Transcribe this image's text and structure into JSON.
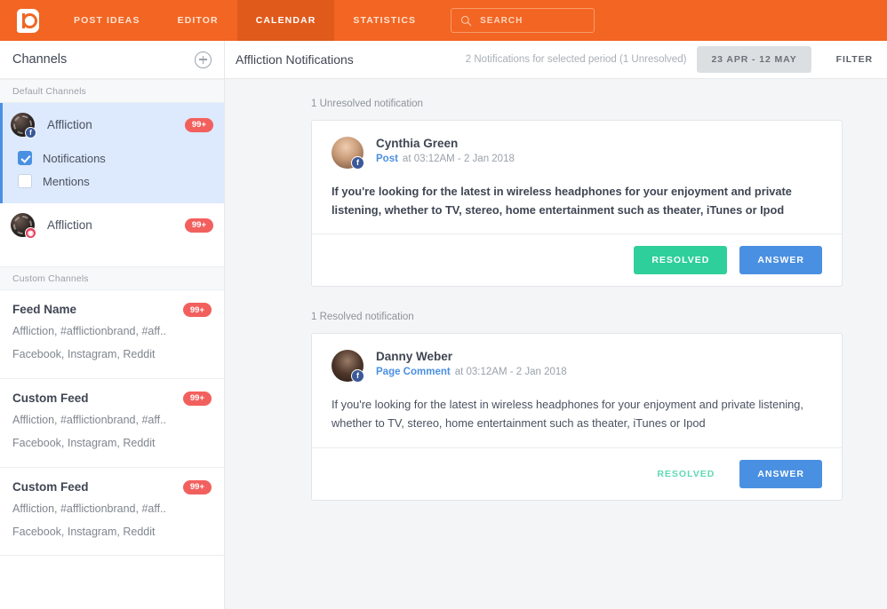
{
  "topnav": {
    "logo_name": "post-planner-logo",
    "items": [
      {
        "label": "POST IDEAS",
        "active": false
      },
      {
        "label": "EDITOR",
        "active": false
      },
      {
        "label": "CALENDAR",
        "active": true
      },
      {
        "label": "STATISTICS",
        "active": false
      }
    ],
    "search_placeholder": "SEARCH",
    "search_value": "",
    "brand_color": "#f26522",
    "active_tab_color": "#e05a1c"
  },
  "sidebar": {
    "title": "Channels",
    "add_button_name": "add-channel",
    "groups": [
      {
        "label": "Default Channels",
        "channels": [
          {
            "name": "Affliction",
            "badge": "99+",
            "network": "facebook",
            "selected": true,
            "subitems": [
              {
                "label": "Notifications",
                "checked": true
              },
              {
                "label": "Mentions",
                "checked": false
              }
            ]
          },
          {
            "name": "Affliction",
            "badge": "99+",
            "network": "instagram",
            "selected": false,
            "subitems": []
          }
        ]
      }
    ],
    "custom_label": "Custom Channels",
    "feeds": [
      {
        "name": "Feed Name",
        "badge": "99+",
        "keywords": "Affliction, #afflictionbrand, #aff..",
        "networks": "Facebook, Instagram, Reddit"
      },
      {
        "name": "Custom Feed",
        "badge": "99+",
        "keywords": "Affliction, #afflictionbrand, #aff..",
        "networks": "Facebook, Instagram, Reddit"
      },
      {
        "name": "Custom Feed",
        "badge": "99+",
        "keywords": "Affliction, #afflictionbrand, #aff..",
        "networks": "Facebook, Instagram, Reddit"
      }
    ],
    "badge_color": "#f2605e"
  },
  "main": {
    "title": "Affliction Notifications",
    "meta": "2 Notifications for selected period (1 Unresolved)",
    "date_range": "23 APR - 12 MAY",
    "filter_label": "FILTER",
    "unresolved_section_label": "1 Unresolved notification",
    "resolved_section_label": "1 Resolved notification",
    "cards": [
      {
        "author": "Cynthia Green",
        "kind": "Post",
        "time": "at 03:12AM - 2 Jan 2018",
        "network": "facebook",
        "message": "If you're looking for the latest in wireless headphones for your enjoyment and private listening, whether to TV, stereo, home entertainment such as theater, iTunes or Ipod",
        "resolved_label": "RESOLVED",
        "answer_label": "ANSWER",
        "resolved_style": "filled"
      },
      {
        "author": "Danny Weber",
        "kind": "Page Comment",
        "time": "at 03:12AM - 2 Jan 2018",
        "network": "facebook",
        "message": "If you're looking for the latest in wireless headphones for your enjoyment and private listening, whether to TV, stereo, home entertainment such as theater, iTunes or Ipod",
        "resolved_label": "RESOLVED",
        "answer_label": "ANSWER",
        "resolved_style": "flat"
      }
    ],
    "accent_green": "#2ecf9b",
    "accent_blue": "#4a90e2"
  }
}
